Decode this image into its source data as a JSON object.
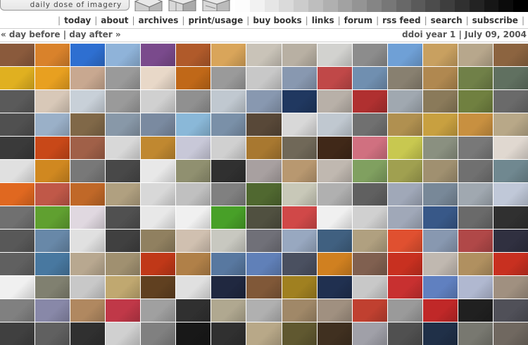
{
  "logo": {
    "text": "daily dose of imagery"
  },
  "nav": {
    "items": [
      {
        "label": "today"
      },
      {
        "label": "about"
      },
      {
        "label": "archives"
      },
      {
        "label": "print/usage"
      },
      {
        "label": "buy books"
      },
      {
        "label": "links"
      },
      {
        "label": "forum"
      },
      {
        "label": "rss feed"
      },
      {
        "label": "search"
      },
      {
        "label": "subscribe"
      }
    ],
    "separator": "|"
  },
  "subnav": {
    "prev_label": "« day before",
    "next_label": "day after »",
    "divider": "|",
    "year_label": "ddoi year 1",
    "date_label": "July 09, 2004"
  },
  "colors": {
    "gradient": [
      "#fdfdfd",
      "#f2f2f2",
      "#e6e6e6",
      "#dadada",
      "#cccccc",
      "#bebebe",
      "#b0b0b0",
      "#a2a2a2",
      "#949494",
      "#858585",
      "#777777",
      "#686868",
      "#5a5a5a",
      "#4c4c4c",
      "#3e3e3e",
      "#303030",
      "#232323",
      "#161616",
      "#0b0b0b",
      "#000000"
    ],
    "thumbnails": [
      [
        "#8a5a3c",
        "#d9822b",
        "#2e6fd1",
        "#8fb3d9",
        "#7a4a8c",
        "#b05a2a",
        "#d9a55a",
        "#c9c3b8",
        "#b8b0a3",
        "#d2d2cf",
        "#8c8c8c",
        "#6fa0d6",
        "#c8a060",
        "#b7a78c",
        "#8c6440"
      ],
      [
        "#e0b020",
        "#e8a020",
        "#c8a890",
        "#9a9a9a",
        "#e8d8c8",
        "#c06818",
        "#9a9a9a",
        "#c8c8c8",
        "#8898b0",
        "#c04848",
        "#708fb0",
        "#888070",
        "#b08850",
        "#708048",
        "#607060"
      ],
      [
        "#5a5a5a",
        "#d8c8b8",
        "#c8d0d8",
        "#9a9a9a",
        "#d0d0d0",
        "#909090",
        "#c0c8d0",
        "#8898b0",
        "#203860",
        "#b8b0a8",
        "#b03030",
        "#a0a8b0",
        "#8a7a5a",
        "#708040",
        "#6a6a6a"
      ],
      [
        "#505050",
        "#9ab0c8",
        "#806848",
        "#8898a8",
        "#7a8aa0",
        "#8ab8d8",
        "#7a90a8",
        "#584838",
        "#d8d8d8",
        "#c0c8d0",
        "#707070",
        "#b09050",
        "#c8a040",
        "#c89040",
        "#b8a888"
      ],
      [
        "#3a3a3a",
        "#c84818",
        "#a06048",
        "#d8d8d8",
        "#c08830",
        "#c8c8d8",
        "#d0d0d0",
        "#a87830",
        "#706858",
        "#402818",
        "#d07080",
        "#c8c850",
        "#8a9080",
        "#787878",
        "#e0d8d0"
      ],
      [
        "#e0e0e0",
        "#d08820",
        "#787878",
        "#484848",
        "#e8e8e8",
        "#909070",
        "#303030",
        "#a8a0a0",
        "#b89870",
        "#c0b8b0",
        "#80a060",
        "#a0a050",
        "#a09070",
        "#707070",
        "#708890"
      ],
      [
        "#e06820",
        "#c05848",
        "#c06828",
        "#b0a080",
        "#d8d8d8",
        "#c0c0c0",
        "#808080",
        "#506830",
        "#c8c8b8",
        "#b0b0b0",
        "#606060",
        "#a0a8b8",
        "#788898",
        "#a0a8b0",
        "#c0c8d8"
      ],
      [
        "#707070",
        "#60a030",
        "#e0d8e0",
        "#505050",
        "#e8e8e8",
        "#f0f0f0",
        "#48a028",
        "#505040",
        "#d04848",
        "#f0f0f0",
        "#d0d0d0",
        "#a0a8b8",
        "#385888",
        "#6a6a6a",
        "#303030"
      ],
      [
        "#585858",
        "#6888a8",
        "#e0e0e0",
        "#404040",
        "#908060",
        "#d0c0b0",
        "#c8c8c0",
        "#707078",
        "#98a8c0",
        "#406080",
        "#b0a080",
        "#e05030",
        "#8898b0",
        "#b04848",
        "#303040"
      ],
      [
        "#606060",
        "#4878a0",
        "#b8a890",
        "#a09070",
        "#c03818",
        "#b08048",
        "#5878a0",
        "#6080b8",
        "#4a5060",
        "#d08020",
        "#806050",
        "#c83020",
        "#c0b8b0",
        "#b09060",
        "#c83020"
      ],
      [
        "#f0f0f0",
        "#808070",
        "#c8c8c8",
        "#c0a870",
        "#604020",
        "#e0e0e0",
        "#202840",
        "#805838",
        "#a08020",
        "#203050",
        "#c8c8c8",
        "#c83030",
        "#6080c0",
        "#b0b8d0",
        "#a09080"
      ],
      [
        "#808080",
        "#8888a8",
        "#b08860",
        "#c03848",
        "#a0a0a0",
        "#303030",
        "#b0a890",
        "#b0b0b0",
        "#a08868",
        "#a09080",
        "#c04030",
        "#9a9a9a",
        "#c02828",
        "#202020",
        "#505058"
      ],
      [
        "#404040",
        "#606060",
        "#303030",
        "#d0d0d0",
        "#808080",
        "#181818",
        "#303030",
        "#b8a888",
        "#605830",
        "#403020",
        "#a0a0a8",
        "#505050",
        "#203048",
        "#787870",
        "#706860"
      ]
    ]
  }
}
